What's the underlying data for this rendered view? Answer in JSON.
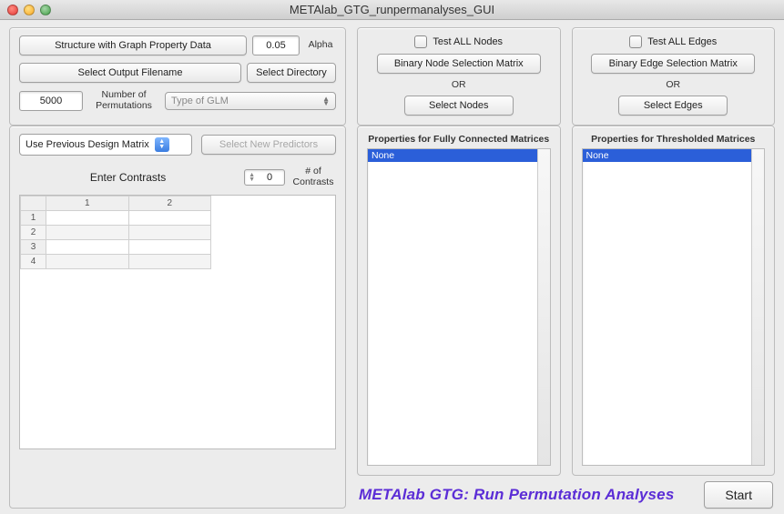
{
  "window": {
    "title": "METAlab_GTG_runpermanalyses_GUI"
  },
  "config": {
    "structure_btn": "Structure with Graph Property Data",
    "alpha_value": "0.05",
    "alpha_label": "Alpha",
    "output_btn": "Select Output Filename",
    "dir_btn": "Select Directory",
    "perm_value": "5000",
    "perm_label": "Number of\nPermutations",
    "glm_placeholder": "Type of GLM"
  },
  "nodes": {
    "check_label": "Test ALL Nodes",
    "matrix_btn": "Binary Node Selection Matrix",
    "or": "OR",
    "select_btn": "Select Nodes"
  },
  "edges": {
    "check_label": "Test ALL Edges",
    "matrix_btn": "Binary Edge Selection Matrix",
    "or": "OR",
    "select_btn": "Select Edges"
  },
  "left": {
    "design_dd": "Use Previous Design Matrix",
    "new_pred_btn": "Select New Predictors",
    "enter_contrasts": "Enter Contrasts",
    "num_contrasts_value": "0",
    "num_contrasts_label": "# of\nContrasts",
    "col_headers": [
      "1",
      "2"
    ],
    "row_headers": [
      "1",
      "2",
      "3",
      "4"
    ]
  },
  "full": {
    "title": "Properties for Fully Connected Matrices",
    "item": "None"
  },
  "thresh": {
    "title": "Properties for Thresholded Matrices",
    "item": "None"
  },
  "footer": {
    "title": "METAlab GTG: Run Permutation Analyses",
    "start": "Start"
  }
}
